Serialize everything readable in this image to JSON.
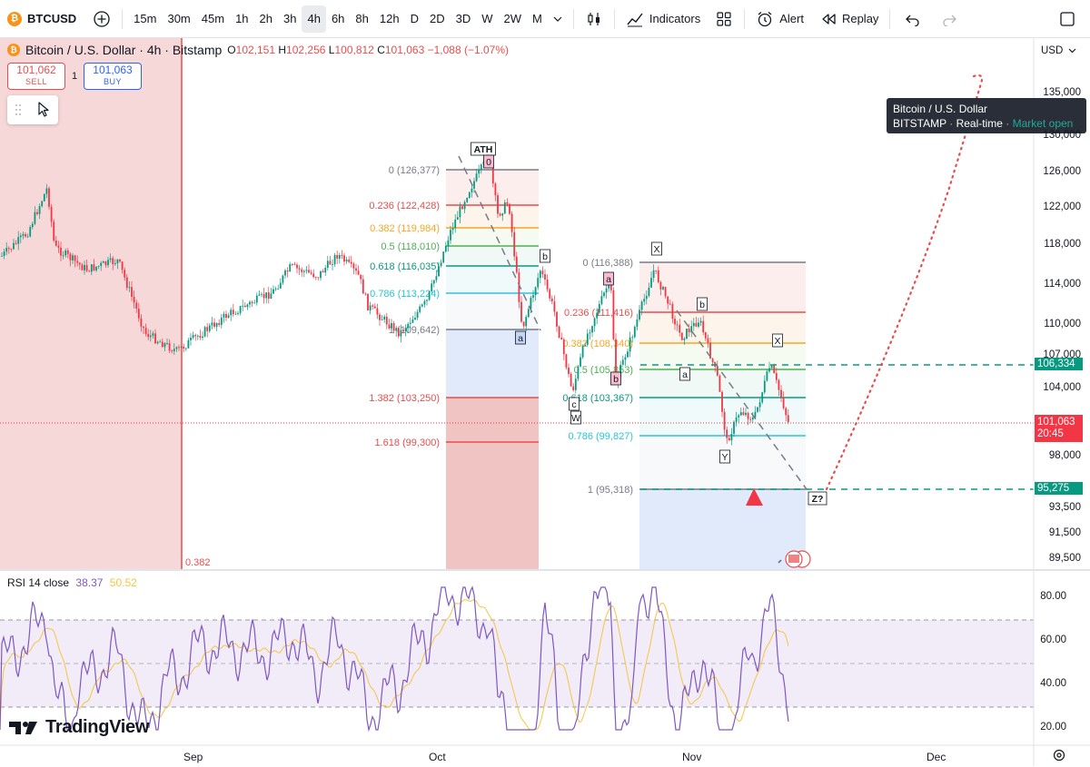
{
  "toolbar": {
    "symbol": "BTCUSD",
    "intervals": [
      "15m",
      "30m",
      "45m",
      "1h",
      "2h",
      "3h",
      "4h",
      "6h",
      "8h",
      "12h",
      "D",
      "2D",
      "3D",
      "W",
      "2W",
      "M"
    ],
    "active_interval": "4h",
    "indicators_label": "Indicators",
    "alert_label": "Alert",
    "replay_label": "Replay"
  },
  "legend": {
    "title": "Bitcoin / U.S. Dollar · 4h · Bitstamp",
    "o_label": "O",
    "o": "102,151",
    "h_label": "H",
    "h": "102,256",
    "l_label": "L",
    "l": "100,812",
    "c_label": "C",
    "c": "101,063",
    "change": "−1,088 (−1.07%)"
  },
  "trade": {
    "sell_price": "101,062",
    "sell_label": "SELL",
    "qty": "1",
    "buy_price": "101,063",
    "buy_label": "BUY"
  },
  "tooltip": {
    "title": "Bitcoin / U.S. Dollar",
    "exchange": "BITSTAMP",
    "mode": "Real-time",
    "status": "Market open"
  },
  "currency": "USD",
  "price_axis": [
    "135,000",
    "130,000",
    "126,000",
    "122,000",
    "118,000",
    "114,000",
    "110,000",
    "107,000",
    "104,000",
    "98,000",
    "93,500",
    "91,500",
    "89,500"
  ],
  "price_tags": {
    "target": "106,334",
    "current": "101,063",
    "countdown": "20:45",
    "low": "95,275"
  },
  "fib1_levels": [
    {
      "label": "0 (126,377)",
      "color": "#787b86"
    },
    {
      "label": "0.236 (122,428)",
      "color": "#e84d4d"
    },
    {
      "label": "0.382 (119,984)",
      "color": "#f5a623"
    },
    {
      "label": "0.5 (118,010)",
      "color": "#4caf50"
    },
    {
      "label": "0.618 (116,035)",
      "color": "#089981"
    },
    {
      "label": "0.786 (113,224)",
      "color": "#26c6da"
    },
    {
      "label": "1 (109,642)",
      "color": "#787b86"
    },
    {
      "label": "1.382 (103,250)",
      "color": "#e84d4d"
    },
    {
      "label": "1.618 (99,300)",
      "color": "#e84d4d"
    }
  ],
  "fib2_levels": [
    {
      "label": "0 (116,388)",
      "color": "#787b86"
    },
    {
      "label": "0.236 (111,416)",
      "color": "#e84d4d"
    },
    {
      "label": "0.382 (108,340)",
      "color": "#f5a623"
    },
    {
      "label": "0.5 (105,853)",
      "color": "#4caf50"
    },
    {
      "label": "0.618 (103,367)",
      "color": "#089981"
    },
    {
      "label": "0.786 (99,827)",
      "color": "#26c6da"
    },
    {
      "label": "1 (95,318)",
      "color": "#787b86"
    }
  ],
  "wave_labels": [
    "ATH",
    "0",
    "b",
    "a",
    "c",
    "W",
    "a",
    "b",
    "X",
    "b",
    "a",
    "X",
    "Y",
    "Z?"
  ],
  "left_fib_label": "0.382",
  "rsi": {
    "label": "RSI 14 close",
    "value": "38.37",
    "ma": "50.52",
    "axis": [
      "80.00",
      "60.00",
      "40.00",
      "20.00"
    ]
  },
  "time_axis": [
    "Sep",
    "Oct",
    "Nov",
    "Dec"
  ],
  "brand": "TradingView",
  "colors": {
    "up": "#089981",
    "down": "#f23645",
    "rsi_line": "#7e57c2",
    "rsi_ma": "#f5c542",
    "accent": "#2962ff"
  }
}
